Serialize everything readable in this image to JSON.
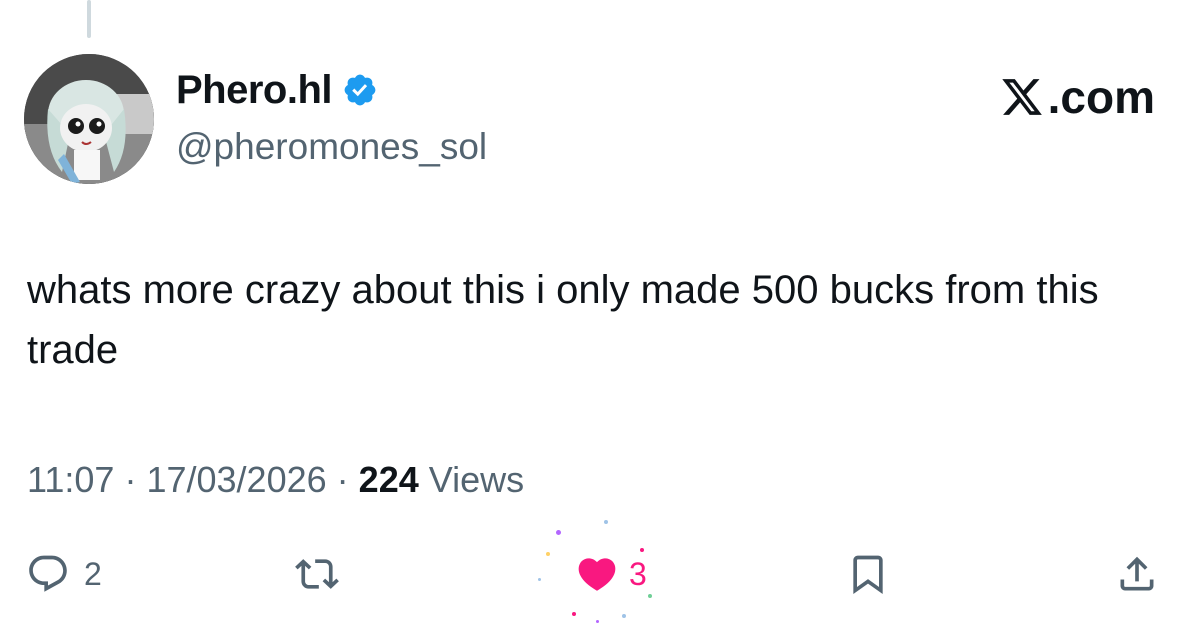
{
  "author": {
    "display_name": "Phero.hl",
    "handle": "@pheromones_sol",
    "verified": true,
    "avatar": "anime-character-avatar"
  },
  "brand": {
    "label": ".com",
    "icon": "x-logo-icon"
  },
  "tweet": {
    "text": "whats more crazy about this i only made 500 bucks from this trade",
    "time": "11:07",
    "date": "17/03/2026",
    "separator": "·",
    "views_count": "224",
    "views_label": "Views"
  },
  "actions": {
    "reply": {
      "icon": "reply-icon",
      "count": "2"
    },
    "retweet": {
      "icon": "retweet-icon",
      "count": ""
    },
    "like": {
      "icon": "heart-icon",
      "count": "3",
      "liked": true
    },
    "bookmark": {
      "icon": "bookmark-icon"
    },
    "share": {
      "icon": "share-icon"
    }
  },
  "colors": {
    "text_primary": "#0f1419",
    "text_secondary": "#536471",
    "verified_blue": "#1d9bf0",
    "like_pink": "#f91880"
  }
}
